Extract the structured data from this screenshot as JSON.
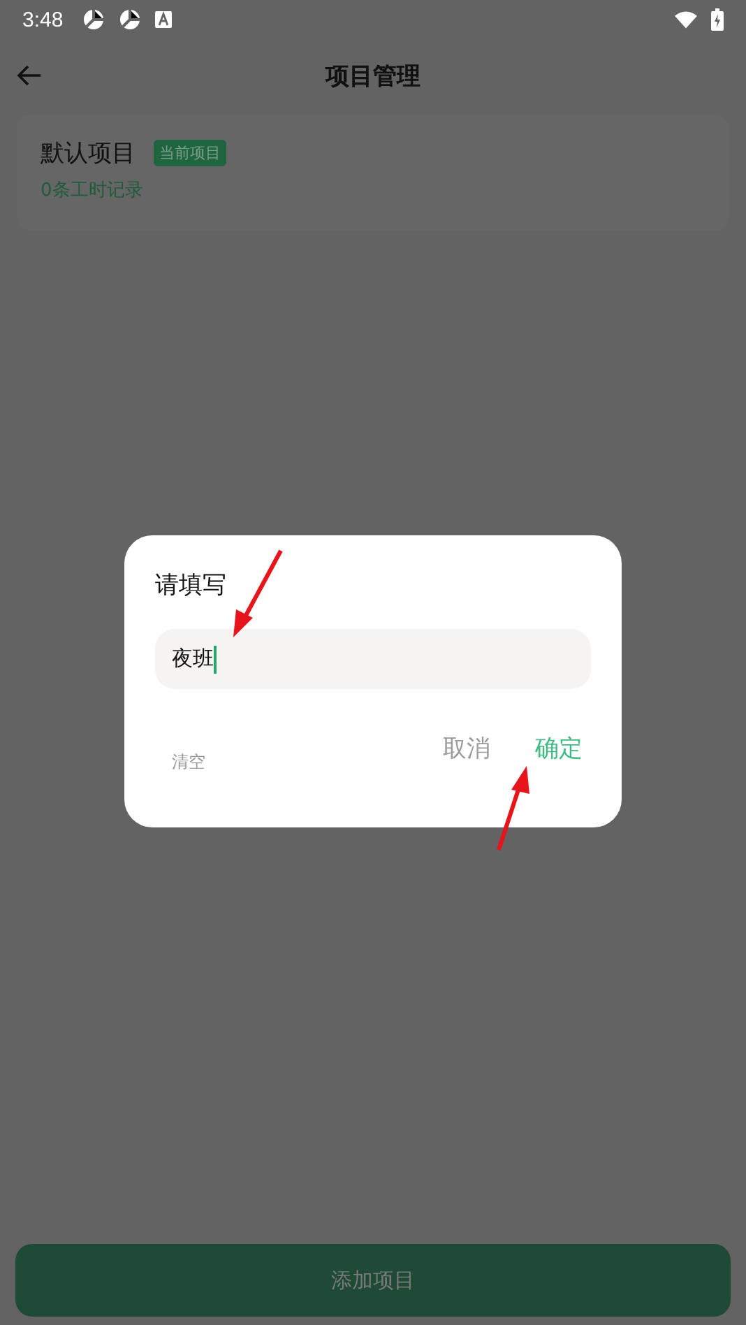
{
  "status_bar": {
    "time": "3:48"
  },
  "app_bar": {
    "title": "项目管理"
  },
  "projects": [
    {
      "name": "默认项目",
      "badge": "当前项目",
      "records": "0条工时记录"
    }
  ],
  "dialog": {
    "title": "请填写",
    "input": {
      "value": "夜班"
    },
    "clear": "清空",
    "cancel": "取消",
    "confirm": "确定"
  },
  "add_button": "添加项目"
}
